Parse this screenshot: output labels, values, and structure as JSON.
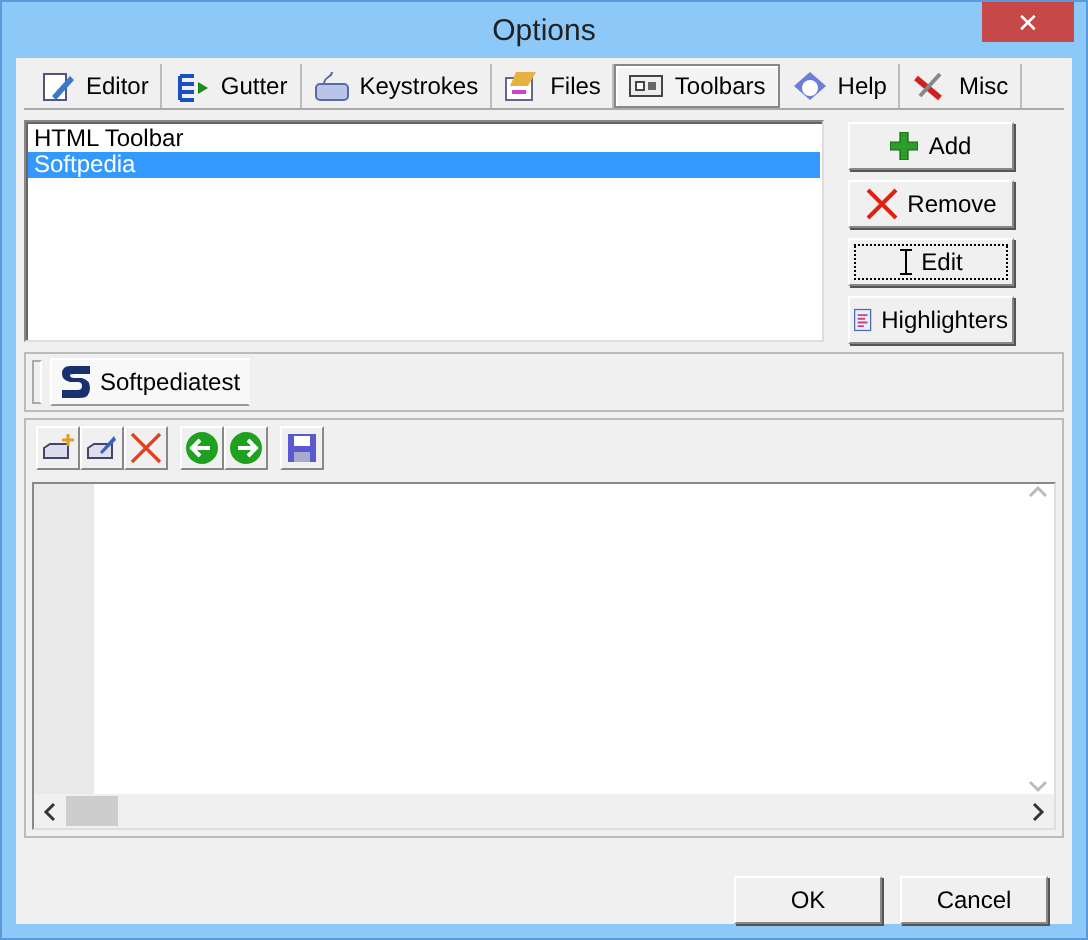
{
  "window": {
    "title": "Options",
    "close": "✕"
  },
  "tabs": [
    {
      "label": "Editor",
      "selected": false
    },
    {
      "label": "Gutter",
      "selected": false
    },
    {
      "label": "Keystrokes",
      "selected": false
    },
    {
      "label": "Files",
      "selected": false
    },
    {
      "label": "Toolbars",
      "selected": true
    },
    {
      "label": "Help",
      "selected": false
    },
    {
      "label": "Misc",
      "selected": false
    }
  ],
  "toolbar_list": [
    {
      "label": "HTML Toolbar",
      "selected": false
    },
    {
      "label": "Softpedia",
      "selected": true
    }
  ],
  "side_buttons": [
    "Add",
    "Remove",
    "Edit",
    "Highlighters"
  ],
  "toolbar_tabs": [
    {
      "label": "Softpediatest",
      "selected": true
    }
  ],
  "buttons": [
    "OK",
    "Cancel"
  ]
}
